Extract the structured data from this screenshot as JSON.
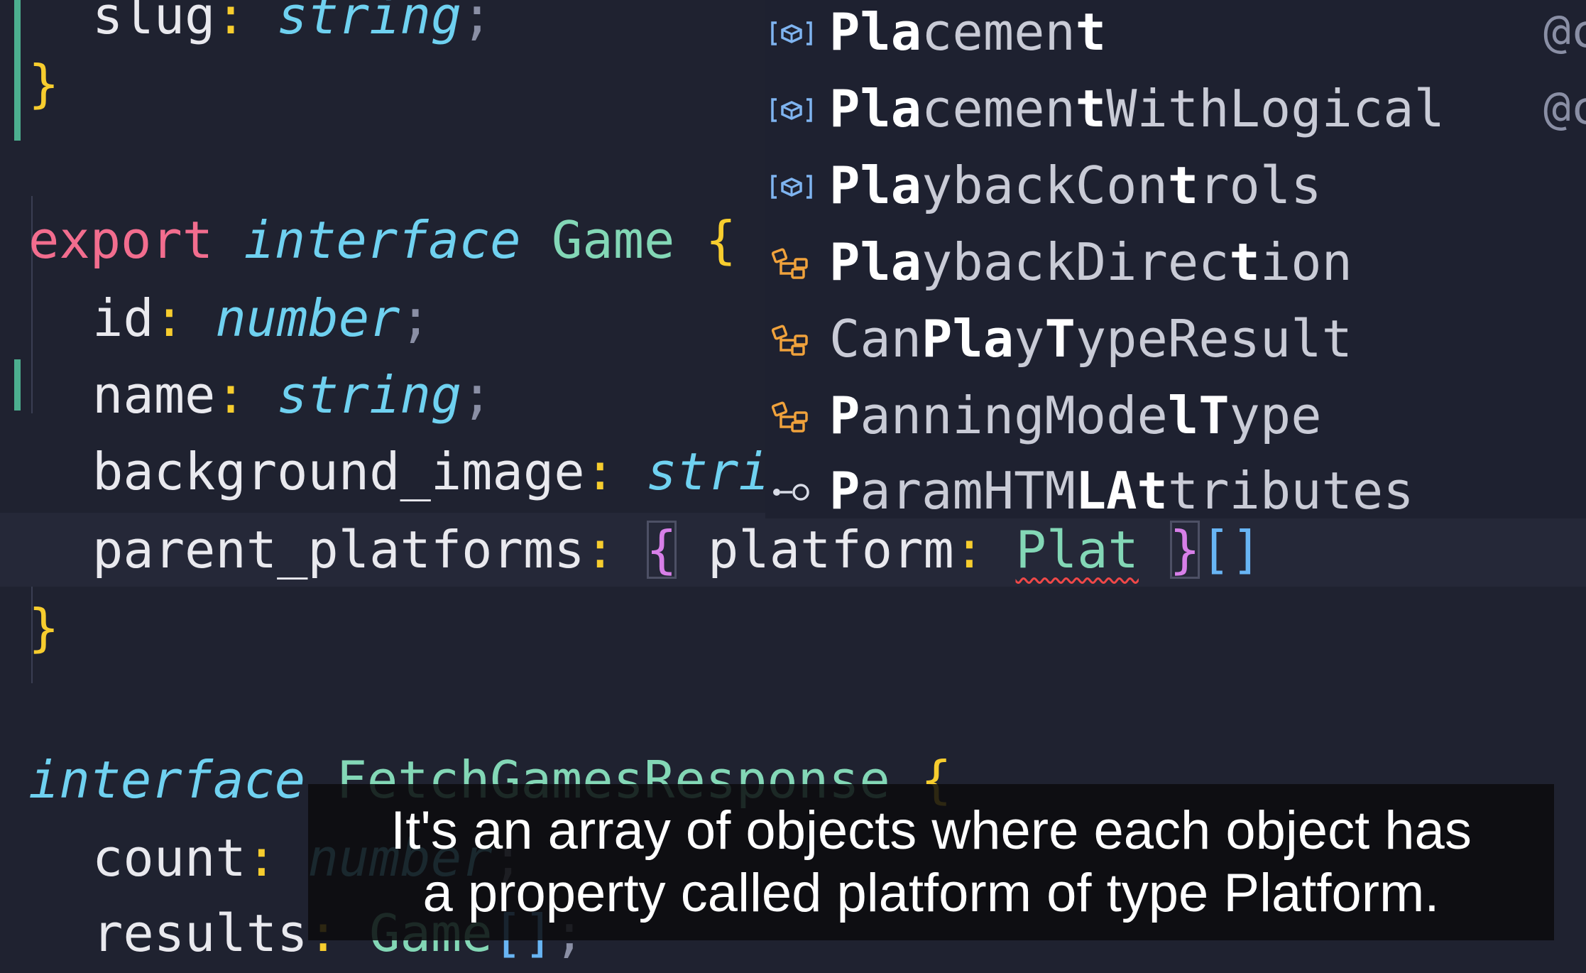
{
  "editor": {
    "lines": {
      "slug_prop": "slug",
      "slug_colon": ":",
      "slug_type": "string",
      "slug_semi": ";",
      "close1": "}",
      "export_kw": "export",
      "interface_kw": "interface",
      "game_name": "Game",
      "open_brace": "{",
      "id_prop": "id",
      "id_type": "number",
      "name_prop": "name",
      "name_type": "string",
      "bg_prop": "background_image",
      "bg_type": "stri",
      "pp_prop": "parent_platforms",
      "pp_open": "{",
      "pp_inner_prop": "platform",
      "pp_inner_type": "Plat",
      "pp_close": "}",
      "pp_array": "[]",
      "close2": "}",
      "interface2_kw": "interface",
      "fetch_name": "FetchGamesResponse",
      "open_brace2": "{",
      "count_prop": "count",
      "count_type": "number",
      "results_prop": "results",
      "results_type": "Game",
      "results_array": "[]",
      "colon": ":",
      "semi": ";"
    }
  },
  "suggestions": [
    {
      "icon": "variable-icon",
      "pre": "",
      "bold1": "Pla",
      "mid": "cemen",
      "bold2": "t",
      "post": "",
      "detail": "@c"
    },
    {
      "icon": "variable-icon",
      "pre": "",
      "bold1": "Pla",
      "mid": "cemen",
      "bold2": "t",
      "post": "WithLogical",
      "detail": "@c"
    },
    {
      "icon": "variable-icon",
      "pre": "",
      "bold1": "Pla",
      "mid": "ybackCon",
      "bold2": "t",
      "post": "rols",
      "detail": ""
    },
    {
      "icon": "type-parameter-icon",
      "pre": "",
      "bold1": "Pla",
      "mid": "ybackDirec",
      "bold2": "t",
      "post": "ion",
      "detail": ""
    },
    {
      "icon": "type-parameter-icon",
      "pre": "Can",
      "bold1": "Pla",
      "mid": "y",
      "bold2": "T",
      "post": "ypeResult",
      "detail": ""
    },
    {
      "icon": "type-parameter-icon",
      "pre": "",
      "bold1": "P",
      "mid": "anningMode",
      "bold2": "lT",
      "post": "ype",
      "detail": ""
    },
    {
      "icon": "interface-icon",
      "pre": "",
      "bold1": "P",
      "mid": "aramHTM",
      "bold2": "LAt",
      "post": "tributes",
      "detail": ""
    }
  ],
  "subtitle": {
    "line1": "It's an array of objects where each object has",
    "line2": "a property called platform of type Platform."
  },
  "colors": {
    "background": "#1f2230",
    "keyword": "#f26d8e",
    "type_keyword": "#6fd1f0",
    "class_name": "#83d7b6",
    "brace": "#f7cd2e",
    "gutter_modified": "#4caf8f",
    "icon_variable": "#7fb4f0",
    "icon_type_param": "#f0a23c"
  }
}
